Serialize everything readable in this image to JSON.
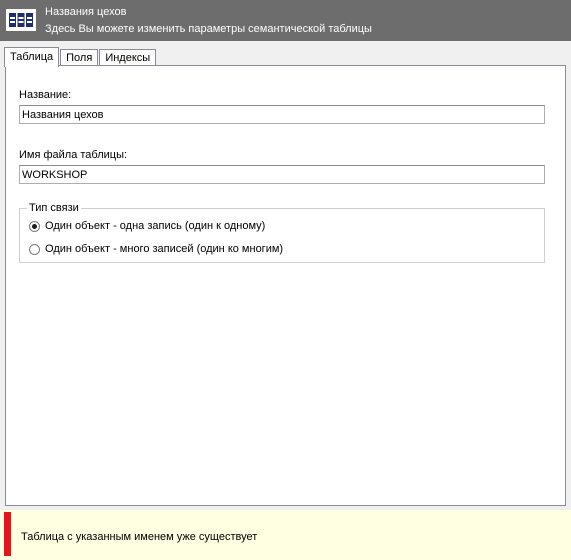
{
  "header": {
    "title": "Названия цехов",
    "subtitle": "Здесь Вы можете изменить параметры семантической таблицы",
    "icon": "table-icon",
    "background_color": "#6d6d6d"
  },
  "tabs": [
    {
      "label": "Таблица",
      "active": true
    },
    {
      "label": "Поля",
      "active": false
    },
    {
      "label": "Индексы",
      "active": false
    }
  ],
  "form": {
    "name_label": "Название:",
    "name_value": "Названия цехов",
    "filename_label": "Имя файла таблицы:",
    "filename_value": "WORKSHOP",
    "relation_group": {
      "legend": "Тип связи",
      "options": [
        {
          "label": "Один объект - одна запись (один к одному)",
          "checked": true
        },
        {
          "label": "Один объект - много записей (один ко многим)",
          "checked": false
        }
      ]
    }
  },
  "status": {
    "message": "Таблица с указанным именем уже существует",
    "marker_color": "#e8141b",
    "background_color": "#ffffe1"
  }
}
